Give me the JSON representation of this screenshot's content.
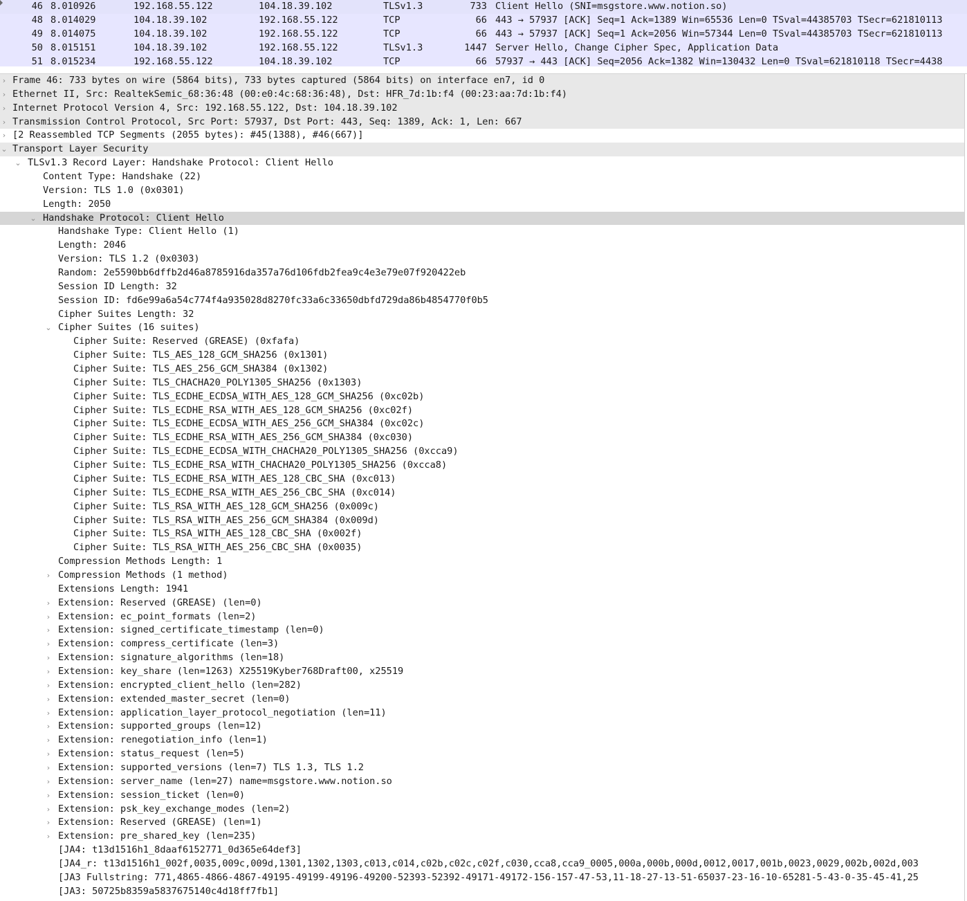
{
  "packet_list": {
    "rows": [
      {
        "no": "46",
        "time": "8.010926",
        "src": "192.168.55.122",
        "dst": "104.18.39.102",
        "proto": "TLSv1.3",
        "len": "733",
        "info": "Client Hello (SNI=msgstore.www.notion.so)",
        "selected": true
      },
      {
        "no": "48",
        "time": "8.014029",
        "src": "104.18.39.102",
        "dst": "192.168.55.122",
        "proto": "TCP",
        "len": "66",
        "info": "443 → 57937 [ACK] Seq=1 Ack=1389 Win=65536 Len=0 TSval=44385703 TSecr=621810113"
      },
      {
        "no": "49",
        "time": "8.014075",
        "src": "104.18.39.102",
        "dst": "192.168.55.122",
        "proto": "TCP",
        "len": "66",
        "info": "443 → 57937 [ACK] Seq=1 Ack=2056 Win=57344 Len=0 TSval=44385703 TSecr=621810113"
      },
      {
        "no": "50",
        "time": "8.015151",
        "src": "104.18.39.102",
        "dst": "192.168.55.122",
        "proto": "TLSv1.3",
        "len": "1447",
        "info": "Server Hello, Change Cipher Spec, Application Data"
      },
      {
        "no": "51",
        "time": "8.015234",
        "src": "192.168.55.122",
        "dst": "104.18.39.102",
        "proto": "TCP",
        "len": "66",
        "info": "57937 → 443 [ACK] Seq=2056 Ack=1382 Win=130432 Len=0 TSval=621810118 TSecr=4438"
      }
    ]
  },
  "detail_tree": {
    "rows": [
      {
        "level": 0,
        "arrow": "collapsed",
        "style": "hl",
        "text": "Frame 46: 733 bytes on wire (5864 bits), 733 bytes captured (5864 bits) on interface en7, id 0"
      },
      {
        "level": 0,
        "arrow": "collapsed",
        "style": "hl",
        "text": "Ethernet II, Src: RealtekSemic_68:36:48 (00:e0:4c:68:36:48), Dst: HFR_7d:1b:f4 (00:23:aa:7d:1b:f4)"
      },
      {
        "level": 0,
        "arrow": "collapsed",
        "style": "hl",
        "text": "Internet Protocol Version 4, Src: 192.168.55.122, Dst: 104.18.39.102"
      },
      {
        "level": 0,
        "arrow": "collapsed",
        "style": "hl",
        "text": "Transmission Control Protocol, Src Port: 57937, Dst Port: 443, Seq: 1389, Ack: 1, Len: 667"
      },
      {
        "level": 0,
        "arrow": "collapsed",
        "style": "",
        "text": "[2 Reassembled TCP Segments (2055 bytes): #45(1388), #46(667)]"
      },
      {
        "level": 0,
        "arrow": "expanded",
        "style": "hl",
        "text": "Transport Layer Security"
      },
      {
        "level": 1,
        "arrow": "expanded",
        "style": "",
        "text": "TLSv1.3 Record Layer: Handshake Protocol: Client Hello"
      },
      {
        "level": 2,
        "arrow": "none",
        "style": "",
        "text": "Content Type: Handshake (22)"
      },
      {
        "level": 2,
        "arrow": "none",
        "style": "",
        "text": "Version: TLS 1.0 (0x0301)"
      },
      {
        "level": 2,
        "arrow": "none",
        "style": "",
        "text": "Length: 2050"
      },
      {
        "level": 2,
        "arrow": "expanded",
        "style": "sel",
        "text": "Handshake Protocol: Client Hello"
      },
      {
        "level": 3,
        "arrow": "none",
        "style": "",
        "text": "Handshake Type: Client Hello (1)"
      },
      {
        "level": 3,
        "arrow": "none",
        "style": "",
        "text": "Length: 2046"
      },
      {
        "level": 3,
        "arrow": "none",
        "style": "",
        "text": "Version: TLS 1.2 (0x0303)"
      },
      {
        "level": 3,
        "arrow": "none",
        "style": "",
        "text": "Random: 2e5590bb6dffb2d46a8785916da357a76d106fdb2fea9c4e3e79e07f920422eb"
      },
      {
        "level": 3,
        "arrow": "none",
        "style": "",
        "text": "Session ID Length: 32"
      },
      {
        "level": 3,
        "arrow": "none",
        "style": "",
        "text": "Session ID: fd6e99a6a54c774f4a935028d8270fc33a6c33650dbfd729da86b4854770f0b5"
      },
      {
        "level": 3,
        "arrow": "none",
        "style": "",
        "text": "Cipher Suites Length: 32"
      },
      {
        "level": 3,
        "arrow": "expanded",
        "style": "",
        "text": "Cipher Suites (16 suites)"
      },
      {
        "level": 4,
        "arrow": "none",
        "style": "",
        "text": "Cipher Suite: Reserved (GREASE) (0xfafa)"
      },
      {
        "level": 4,
        "arrow": "none",
        "style": "",
        "text": "Cipher Suite: TLS_AES_128_GCM_SHA256 (0x1301)"
      },
      {
        "level": 4,
        "arrow": "none",
        "style": "",
        "text": "Cipher Suite: TLS_AES_256_GCM_SHA384 (0x1302)"
      },
      {
        "level": 4,
        "arrow": "none",
        "style": "",
        "text": "Cipher Suite: TLS_CHACHA20_POLY1305_SHA256 (0x1303)"
      },
      {
        "level": 4,
        "arrow": "none",
        "style": "",
        "text": "Cipher Suite: TLS_ECDHE_ECDSA_WITH_AES_128_GCM_SHA256 (0xc02b)"
      },
      {
        "level": 4,
        "arrow": "none",
        "style": "",
        "text": "Cipher Suite: TLS_ECDHE_RSA_WITH_AES_128_GCM_SHA256 (0xc02f)"
      },
      {
        "level": 4,
        "arrow": "none",
        "style": "",
        "text": "Cipher Suite: TLS_ECDHE_ECDSA_WITH_AES_256_GCM_SHA384 (0xc02c)"
      },
      {
        "level": 4,
        "arrow": "none",
        "style": "",
        "text": "Cipher Suite: TLS_ECDHE_RSA_WITH_AES_256_GCM_SHA384 (0xc030)"
      },
      {
        "level": 4,
        "arrow": "none",
        "style": "",
        "text": "Cipher Suite: TLS_ECDHE_ECDSA_WITH_CHACHA20_POLY1305_SHA256 (0xcca9)"
      },
      {
        "level": 4,
        "arrow": "none",
        "style": "",
        "text": "Cipher Suite: TLS_ECDHE_RSA_WITH_CHACHA20_POLY1305_SHA256 (0xcca8)"
      },
      {
        "level": 4,
        "arrow": "none",
        "style": "",
        "text": "Cipher Suite: TLS_ECDHE_RSA_WITH_AES_128_CBC_SHA (0xc013)"
      },
      {
        "level": 4,
        "arrow": "none",
        "style": "",
        "text": "Cipher Suite: TLS_ECDHE_RSA_WITH_AES_256_CBC_SHA (0xc014)"
      },
      {
        "level": 4,
        "arrow": "none",
        "style": "",
        "text": "Cipher Suite: TLS_RSA_WITH_AES_128_GCM_SHA256 (0x009c)"
      },
      {
        "level": 4,
        "arrow": "none",
        "style": "",
        "text": "Cipher Suite: TLS_RSA_WITH_AES_256_GCM_SHA384 (0x009d)"
      },
      {
        "level": 4,
        "arrow": "none",
        "style": "",
        "text": "Cipher Suite: TLS_RSA_WITH_AES_128_CBC_SHA (0x002f)"
      },
      {
        "level": 4,
        "arrow": "none",
        "style": "",
        "text": "Cipher Suite: TLS_RSA_WITH_AES_256_CBC_SHA (0x0035)"
      },
      {
        "level": 3,
        "arrow": "none",
        "style": "",
        "text": "Compression Methods Length: 1"
      },
      {
        "level": 3,
        "arrow": "collapsed",
        "style": "",
        "text": "Compression Methods (1 method)"
      },
      {
        "level": 3,
        "arrow": "none",
        "style": "",
        "text": "Extensions Length: 1941"
      },
      {
        "level": 3,
        "arrow": "collapsed",
        "style": "",
        "text": "Extension: Reserved (GREASE) (len=0)"
      },
      {
        "level": 3,
        "arrow": "collapsed",
        "style": "",
        "text": "Extension: ec_point_formats (len=2)"
      },
      {
        "level": 3,
        "arrow": "collapsed",
        "style": "",
        "text": "Extension: signed_certificate_timestamp (len=0)"
      },
      {
        "level": 3,
        "arrow": "collapsed",
        "style": "",
        "text": "Extension: compress_certificate (len=3)"
      },
      {
        "level": 3,
        "arrow": "collapsed",
        "style": "",
        "text": "Extension: signature_algorithms (len=18)"
      },
      {
        "level": 3,
        "arrow": "collapsed",
        "style": "",
        "text": "Extension: key_share (len=1263) X25519Kyber768Draft00, x25519"
      },
      {
        "level": 3,
        "arrow": "collapsed",
        "style": "",
        "text": "Extension: encrypted_client_hello (len=282)"
      },
      {
        "level": 3,
        "arrow": "collapsed",
        "style": "",
        "text": "Extension: extended_master_secret (len=0)"
      },
      {
        "level": 3,
        "arrow": "collapsed",
        "style": "",
        "text": "Extension: application_layer_protocol_negotiation (len=11)"
      },
      {
        "level": 3,
        "arrow": "collapsed",
        "style": "",
        "text": "Extension: supported_groups (len=12)"
      },
      {
        "level": 3,
        "arrow": "collapsed",
        "style": "",
        "text": "Extension: renegotiation_info (len=1)"
      },
      {
        "level": 3,
        "arrow": "collapsed",
        "style": "",
        "text": "Extension: status_request (len=5)"
      },
      {
        "level": 3,
        "arrow": "collapsed",
        "style": "",
        "text": "Extension: supported_versions (len=7) TLS 1.3, TLS 1.2"
      },
      {
        "level": 3,
        "arrow": "collapsed",
        "style": "",
        "text": "Extension: server_name (len=27) name=msgstore.www.notion.so"
      },
      {
        "level": 3,
        "arrow": "collapsed",
        "style": "",
        "text": "Extension: session_ticket (len=0)"
      },
      {
        "level": 3,
        "arrow": "collapsed",
        "style": "",
        "text": "Extension: psk_key_exchange_modes (len=2)"
      },
      {
        "level": 3,
        "arrow": "collapsed",
        "style": "",
        "text": "Extension: Reserved (GREASE) (len=1)"
      },
      {
        "level": 3,
        "arrow": "collapsed",
        "style": "",
        "text": "Extension: pre_shared_key (len=235)"
      },
      {
        "level": 3,
        "arrow": "none",
        "style": "",
        "text": "[JA4: t13d1516h1_8daaf6152771_0d365e64def3]"
      },
      {
        "level": 3,
        "arrow": "none",
        "style": "",
        "text": "[JA4_r: t13d1516h1_002f,0035,009c,009d,1301,1302,1303,c013,c014,c02b,c02c,c02f,c030,cca8,cca9_0005,000a,000b,000d,0012,0017,001b,0023,0029,002b,002d,003"
      },
      {
        "level": 3,
        "arrow": "none",
        "style": "",
        "text": "[JA3 Fullstring: 771,4865-4866-4867-49195-49199-49196-49200-52393-52392-49171-49172-156-157-47-53,11-18-27-13-51-65037-23-16-10-65281-5-43-0-35-45-41,25"
      },
      {
        "level": 3,
        "arrow": "none",
        "style": "",
        "text": "[JA3: 50725b8359a5837675140c4d18ff7fb1]"
      }
    ]
  },
  "glyphs": {
    "collapsed": "›",
    "expanded": "⌄"
  },
  "colors": {
    "packet_row_bg": "#e7e6ff",
    "selected_tree_row": "#d6d6d6",
    "top_level_tree_row": "#e8e8e8"
  }
}
